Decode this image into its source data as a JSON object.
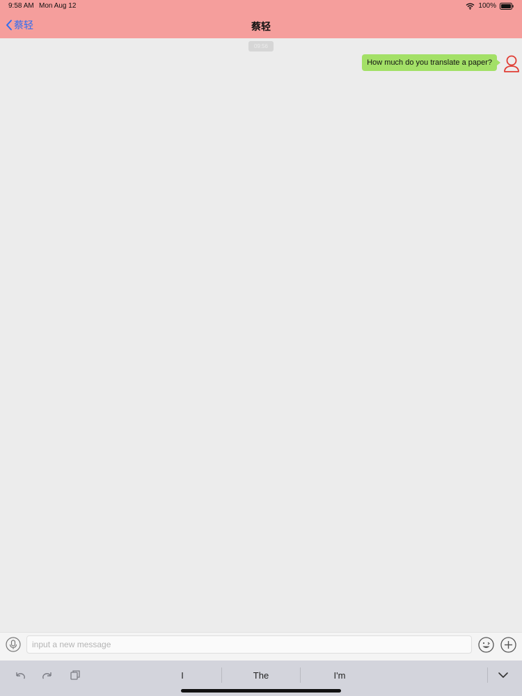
{
  "status_bar": {
    "time": "9:58 AM",
    "date": "Mon Aug 12",
    "battery": "100%"
  },
  "nav": {
    "back_label": "蔡轻",
    "title": "蔡轻"
  },
  "chat": {
    "timestamp": "09:56",
    "messages": [
      {
        "text": "How much do you translate a paper?",
        "from": "me"
      }
    ]
  },
  "input": {
    "placeholder": "input a new message"
  },
  "keyboard": {
    "suggestions": [
      "I",
      "The",
      "I'm"
    ]
  },
  "colors": {
    "header": "#f59e9c",
    "bubble": "#a3e067",
    "accent": "#2f6df0",
    "avatar": "#e03c33"
  },
  "icons": [
    "wifi-icon",
    "battery-icon",
    "chevron-left-icon",
    "user-avatar-icon",
    "microphone-icon",
    "emoji-icon",
    "plus-circle-icon",
    "undo-icon",
    "redo-icon",
    "paste-icon",
    "keyboard-dismiss-icon"
  ]
}
